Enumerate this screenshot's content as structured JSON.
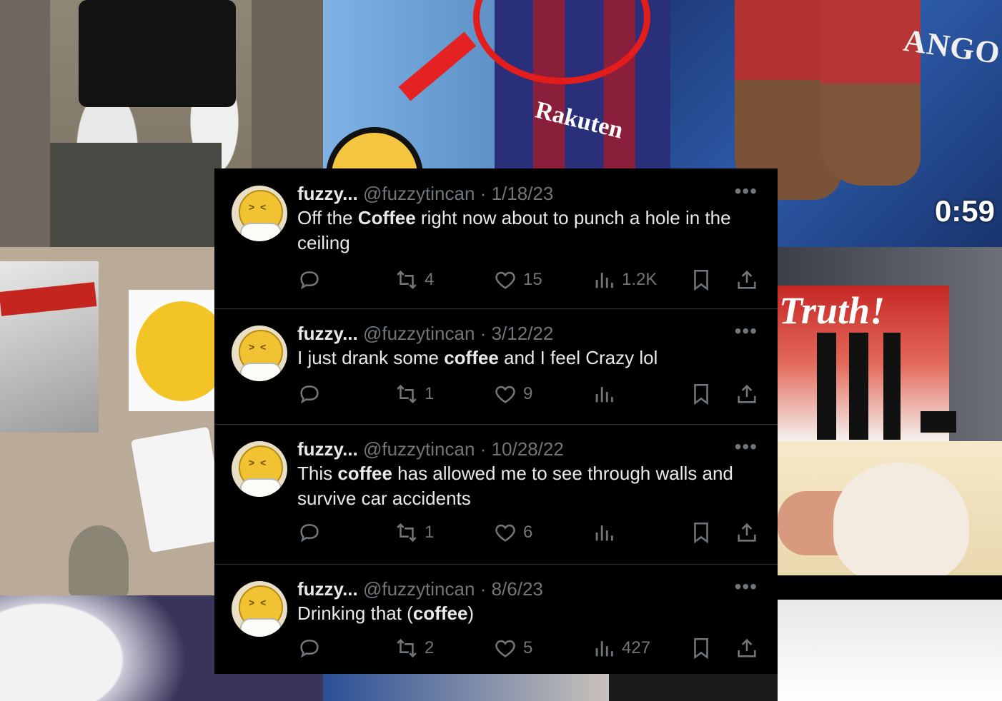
{
  "background": {
    "video_timer": "0:59"
  },
  "tweets": [
    {
      "name": "fuzzy...",
      "handle": "@fuzzytincan",
      "separator": "·",
      "date": "1/18/23",
      "text_parts": [
        "Off the ",
        "Coffee",
        " right now about to punch a hole in the ceiling"
      ],
      "retweets": "4",
      "likes": "15",
      "views": "1.2K"
    },
    {
      "name": "fuzzy...",
      "handle": "@fuzzytincan",
      "separator": "·",
      "date": "3/12/22",
      "text_parts": [
        "I just drank some ",
        "coffee",
        " and I feel Crazy lol"
      ],
      "retweets": "1",
      "likes": "9",
      "views": ""
    },
    {
      "name": "fuzzy...",
      "handle": "@fuzzytincan",
      "separator": "·",
      "date": "10/28/22",
      "text_parts": [
        "This ",
        "coffee",
        " has allowed me to see through walls and survive car accidents"
      ],
      "retweets": "1",
      "likes": "6",
      "views": ""
    },
    {
      "name": "fuzzy...",
      "handle": "@fuzzytincan",
      "separator": "·",
      "date": "8/6/23",
      "text_parts": [
        "Drinking that (",
        "coffee",
        ")"
      ],
      "retweets": "2",
      "likes": "5",
      "views": "427"
    }
  ],
  "icons": {
    "reply": "reply-icon",
    "retweet": "retweet-icon",
    "like": "heart-icon",
    "views": "views-icon",
    "bookmark": "bookmark-icon",
    "share": "share-icon",
    "more": "more-icon"
  },
  "colors": {
    "feed_bg": "#000000",
    "text": "#e7e9ea",
    "muted": "#71767b",
    "divider": "#2f3336"
  }
}
